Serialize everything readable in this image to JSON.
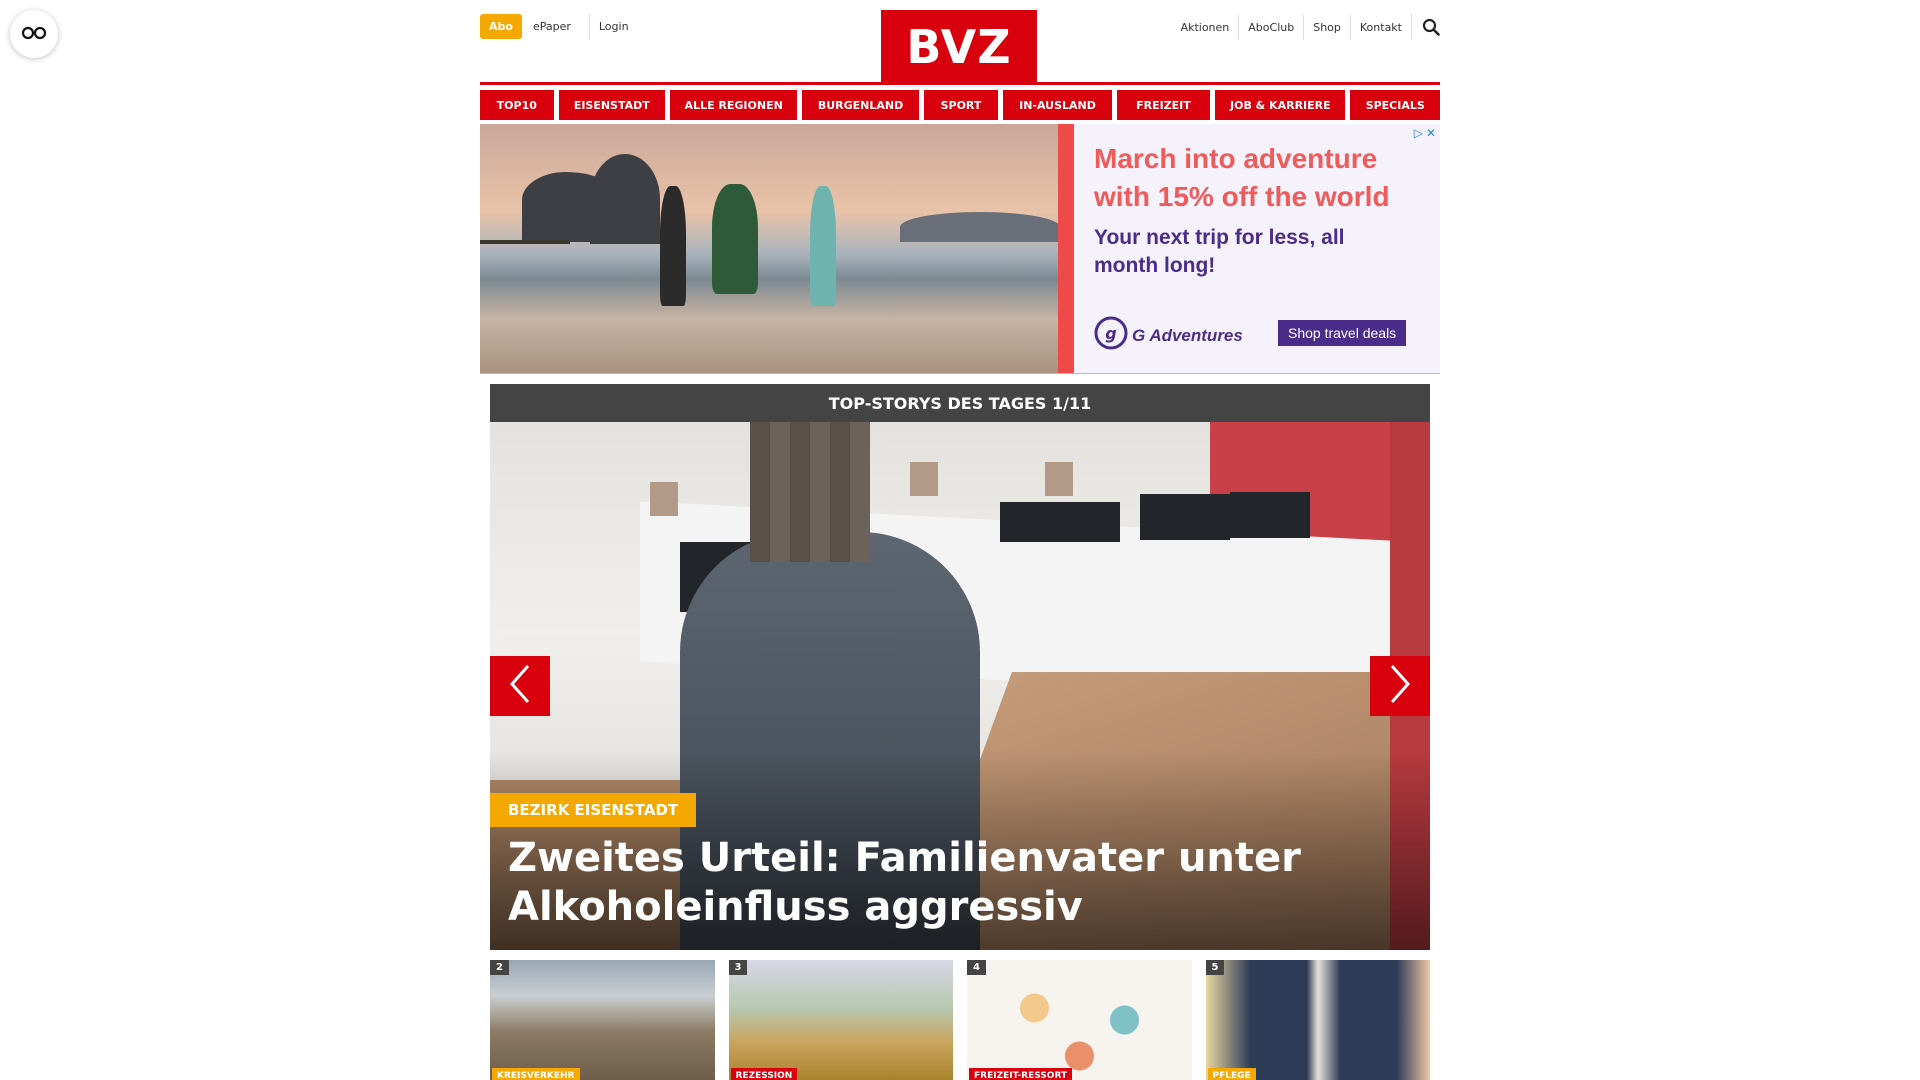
{
  "header": {
    "abo": "Abo",
    "left_links": [
      "ePaper",
      "Login"
    ],
    "logo": "BVZ",
    "right_links": [
      "Aktionen",
      "AboClub",
      "Shop",
      "Kontakt"
    ]
  },
  "nav": [
    {
      "label": "TOP10"
    },
    {
      "label": "EISENSTADT"
    },
    {
      "label": "ALLE REGIONEN"
    },
    {
      "label": "BURGENLAND"
    },
    {
      "label": "SPORT"
    },
    {
      "label": "IN-AUSLAND"
    },
    {
      "label": "FREIZEIT"
    },
    {
      "label": "JOB & KARRIERE"
    },
    {
      "label": "SPECIALS"
    }
  ],
  "ad": {
    "headline": "March into adventure with 15% off the world",
    "subline": "Your next trip for less, all month long!",
    "brand": "G Adventures",
    "cta": "Shop travel deals"
  },
  "top_stories": {
    "heading": "TOP-STORYS DES TAGES 1/11",
    "hero": {
      "tag": "BEZIRK EISENSTADT",
      "title": "Zweites Urteil: Familienvater unter Alkoholeinfluss aggressiv"
    },
    "thumbs": [
      {
        "num": "2",
        "tag": "KREISVERKEHR",
        "tag_color": "yellow"
      },
      {
        "num": "3",
        "tag": "REZESSION",
        "tag_color": "red"
      },
      {
        "num": "4",
        "tag": "FREIZEIT-RESSORT",
        "tag_color": "red"
      },
      {
        "num": "5",
        "tag": "PFLEGE",
        "tag_color": "yellow"
      }
    ]
  },
  "colors": {
    "brand_red": "#d9000d",
    "accent_yellow": "#f5a800",
    "dark_bar": "#444444",
    "ad_purple": "#4a2c8a",
    "ad_coral": "#ef5a5a"
  }
}
